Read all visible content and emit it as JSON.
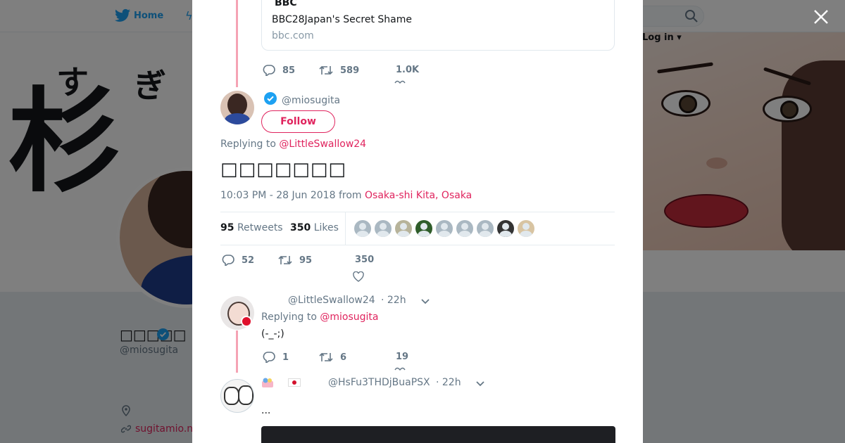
{
  "topbar": {
    "home_label": "Home",
    "login_label": "Log in"
  },
  "profile": {
    "name": "□□□□□",
    "handle": "@miosugita",
    "url": "sugitamio.n",
    "banner_kanji_1": "す",
    "banner_kanji_2": "ぎ",
    "banner_kanji_big": "杉"
  },
  "modal": {
    "link_card": {
      "source": "BBC",
      "title": "BBC28Japan's Secret Shame",
      "domain": "bbc.com"
    },
    "prev_tweet_actions": {
      "replies": "85",
      "retweets": "589",
      "likes": "1.0K"
    },
    "main_tweet": {
      "handle": "@miosugita",
      "follow_label": "Follow",
      "replying_prefix": "Replying to",
      "replying_to": "@LittleSwallow24",
      "text": "□□□□□□□",
      "time": "10:03 PM - 28 Jun 2018",
      "from_prefix": "from",
      "location": "Osaka-shi Kita, Osaka",
      "retweets_count": "95",
      "retweets_label": "Retweets",
      "likes_count": "350",
      "likes_label": "Likes",
      "actions": {
        "replies": "52",
        "retweets": "95",
        "likes": "350"
      }
    },
    "reply1": {
      "handle": "@LittleSwallow24",
      "time": "· 22h",
      "replying_prefix": "Replying to",
      "replying_to": "@miosugita",
      "text": "(-_-;)",
      "actions": {
        "replies": "1",
        "retweets": "6",
        "likes": "19"
      }
    },
    "reply2": {
      "handle": "@HsFu3THDjBuaPSX",
      "time": "· 22h",
      "text": "..."
    }
  },
  "colors": {
    "accent": "#e0245e",
    "thread_line": "#f5a3b4",
    "verified": "#1da1f2",
    "muted": "#657786"
  }
}
